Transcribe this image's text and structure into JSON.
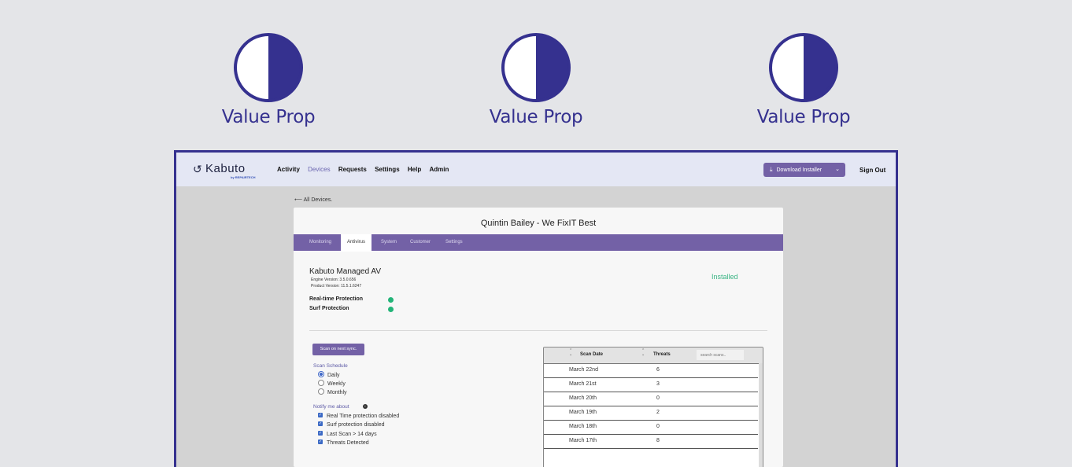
{
  "value_props": [
    {
      "label": "Value Prop",
      "icon": "half-circle-icon"
    },
    {
      "label": "Value Prop",
      "icon": "half-circle-icon"
    },
    {
      "label": "Value Prop",
      "icon": "half-circle-icon"
    }
  ],
  "colors": {
    "accent": "#35318f",
    "purple": "#7361a6",
    "installed": "#3ab484",
    "dot": "#23b478"
  },
  "app": {
    "logo": "Kabuto",
    "logo_sub": "by REPAIRTECH",
    "nav": [
      "Activity",
      "Devices",
      "Requests",
      "Settings",
      "Help",
      "Admin"
    ],
    "nav_active": "Devices",
    "download_label": "Download Installer",
    "signout": "Sign Out"
  },
  "device": {
    "back_link": "All Devices.",
    "title": "Quintin Bailey - We FixIT Best",
    "tabs": [
      "Monitoring",
      "Antivirus",
      "System",
      "Customer",
      "Settings"
    ],
    "active_tab": "Antivirus"
  },
  "av": {
    "title": "Kabuto Managed AV",
    "engine_version": "Engine Version: 3.5.0.656",
    "product_version": "Product Version: 11.5.1.6247",
    "status": "Installed",
    "protections": [
      "Real-time Protection",
      "Surf Protection"
    ]
  },
  "scan": {
    "button": "Scan on next sync.",
    "schedule_label": "Scan Schedule",
    "schedule_options": [
      "Daily",
      "Weekly",
      "Monthly"
    ],
    "schedule_selected": "Daily",
    "notify_label": "Notify me about",
    "notify_options": [
      "Real Time protection disabled",
      "Surf protection disabled",
      "Last Scan > 14 days",
      "Threats Detected"
    ]
  },
  "table": {
    "columns": [
      "Scan Date",
      "Threats"
    ],
    "search_placeholder": "search scans..",
    "rows": [
      {
        "date": "March 22nd",
        "threats": "6"
      },
      {
        "date": "March 21st",
        "threats": "3"
      },
      {
        "date": "March 20th",
        "threats": "0"
      },
      {
        "date": "March 19th",
        "threats": "2"
      },
      {
        "date": "March 18th",
        "threats": "0"
      },
      {
        "date": "March 17th",
        "threats": "8"
      }
    ]
  }
}
